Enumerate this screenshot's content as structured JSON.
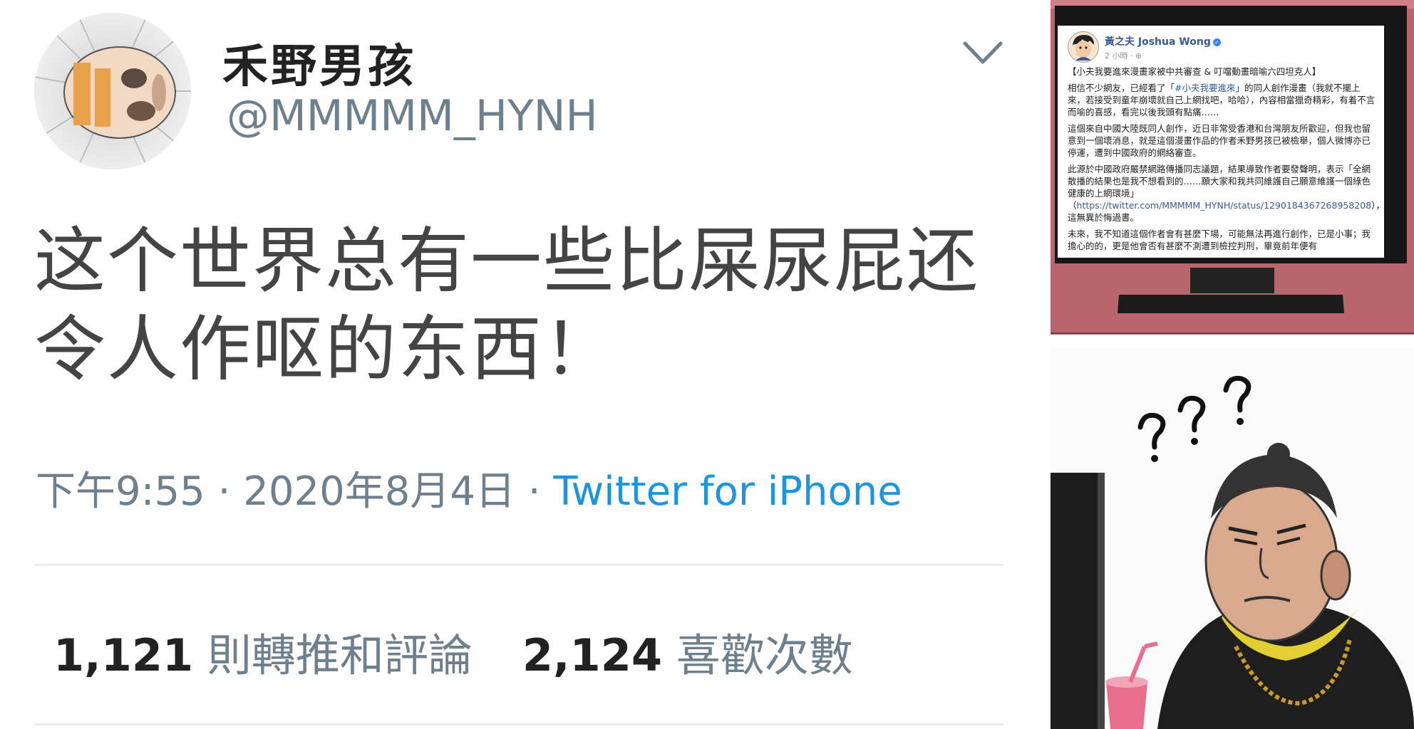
{
  "tweet": {
    "display_name": "禾野男孩",
    "handle": "@MMMMM_HYNH",
    "text": "这个世界总有一些比屎尿屁还令人作呕的东西！",
    "time": "下午9:55",
    "date": "2020年8月4日",
    "separator": "·",
    "source": "Twitter for iPhone",
    "retweets_count": "1,121",
    "retweets_label": "則轉推和評論",
    "likes_count": "2,124",
    "likes_label": "喜歡次數",
    "icons": {
      "avatar": "avatar-image",
      "menu": "chevron-down-icon"
    }
  },
  "facebook_post": {
    "author": "黃之夫 Joshua Wong",
    "time": "2 小時",
    "title": "【小夫我要進來漫畫家被中共審查 & 叮噹動畫暗喻六四坦克人】",
    "p1_before_link": "相信不少網友，已經看了「",
    "p1_link": "#小夫我要進來",
    "p1_after_link": "」的同人創作漫畫（我就不擺上來，若接受到童年崩壞就自己上網找吧，哈哈），內容相當獵奇精彩，有着不言而喻的喜感，看完以後我頭有點痛……",
    "p2": "這個來自中國大陸既同人創作，近日非常受香港和台灣朋友所歡迎，但我也留意到一個壞消息，就是這個漫畫作品的作者禾野男孩已被檢舉，個人微博亦已停運，遭到中國政府的網絡審查。",
    "p3_before_link": "此源於中國政府嚴禁網路傳播同志議題，結果導致作者要發聲明，表示「全網散播的結果也是我不想看到的……願大家和我共同維護自己願意維護一個綠色健康的上網環境」（",
    "p3_link": "https://twitter.com/MMMMM_HYNH/status/1290184367268958208",
    "p3_after_link": "），這無異於悔過書。",
    "p4": "未來，我不知道這個作者會有甚麼下場，可能無法再進行創作，已是小事；我擔心的的，更是他會否有甚麼不測遭到檢控判刑，畢竟前年便有"
  },
  "comic": {
    "question_marks": "? ? ?"
  },
  "colors": {
    "twitter_blue": "#1b95e0",
    "gray_text": "#6e7f8d",
    "wall_red": "#b9656e",
    "facebook_link": "#385898"
  }
}
